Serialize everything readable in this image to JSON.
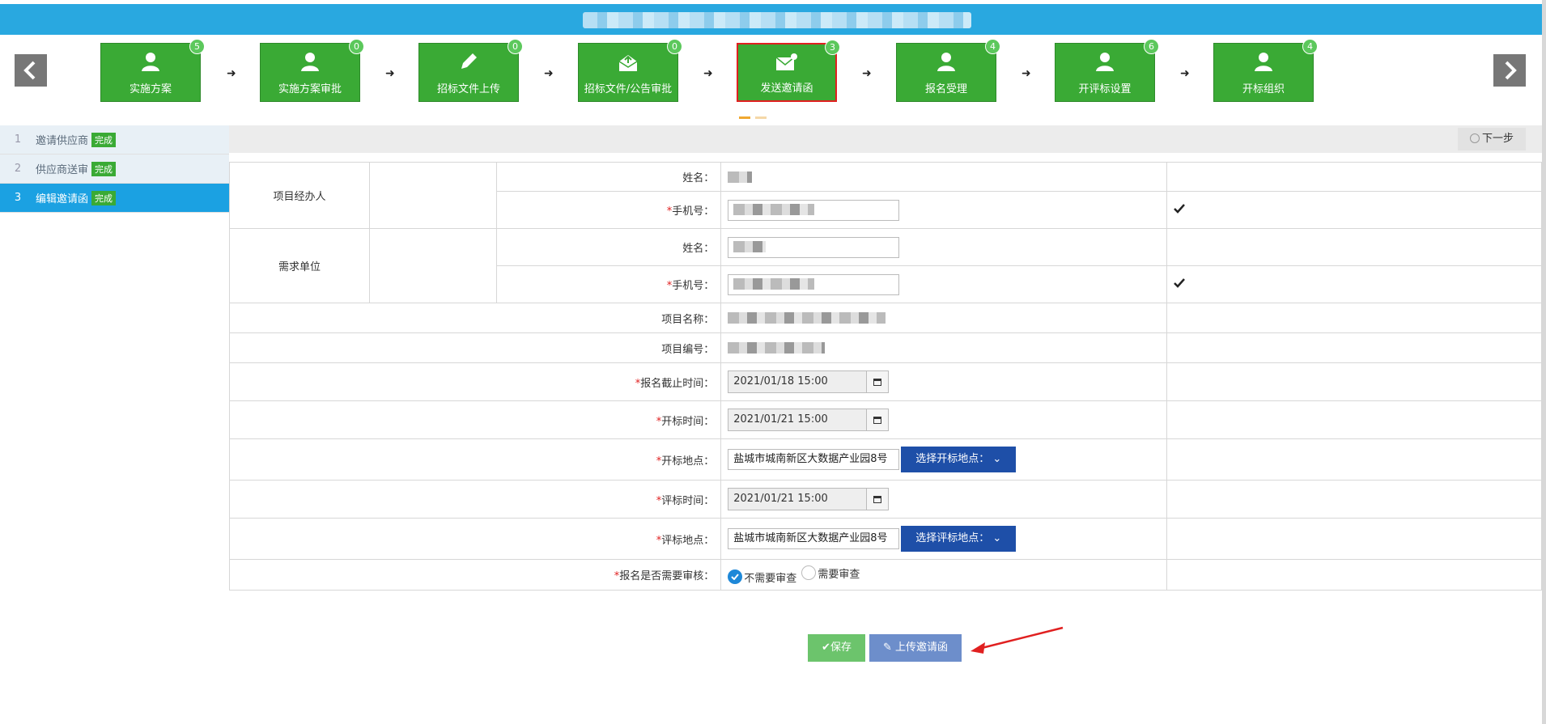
{
  "workflow": {
    "prev_icon": "chevron-left-icon",
    "next_icon": "chevron-right-icon",
    "steps": [
      {
        "label": "实施方案",
        "badge": "5",
        "icon": "user-icon"
      },
      {
        "label": "实施方案审批",
        "badge": "0",
        "icon": "user-icon"
      },
      {
        "label": "招标文件上传",
        "badge": "0",
        "icon": "pencil-icon"
      },
      {
        "label": "招标文件/公告审批",
        "badge": "0",
        "icon": "mail-upload-icon"
      },
      {
        "label": "发送邀请函",
        "badge": "3",
        "icon": "mail-send-icon",
        "active": true
      },
      {
        "label": "报名受理",
        "badge": "4",
        "icon": "user-icon"
      },
      {
        "label": "开评标设置",
        "badge": "6",
        "icon": "user-icon"
      },
      {
        "label": "开标组织",
        "badge": "4",
        "icon": "user-icon"
      }
    ]
  },
  "sidebar": {
    "items": [
      {
        "num": "1",
        "label": "邀请供应商",
        "status": "完成"
      },
      {
        "num": "2",
        "label": "供应商送审",
        "status": "完成"
      },
      {
        "num": "3",
        "label": "编辑邀请函",
        "status": "完成",
        "active": true
      }
    ]
  },
  "toolbar": {
    "next_label": "下一步"
  },
  "form": {
    "group_manager": "项目经办人",
    "group_dept": "需求单位",
    "name_label": "姓名：",
    "phone_label": "手机号：",
    "required_mark": "*",
    "project_name_label": "项目名称：",
    "project_no_label": "项目编号：",
    "signup_deadline_label": "报名截止时间：",
    "signup_deadline_value": "2021/01/18 15:00",
    "open_time_label": "开标时间：",
    "open_time_value": "2021/01/21 15:00",
    "open_place_label": "开标地点：",
    "open_place_value": "盐城市城南新区大数据产业园8号",
    "open_place_button": "选择开标地点：",
    "eval_time_label": "评标时间：",
    "eval_time_value": "2021/01/21 15:00",
    "eval_place_label": "评标地点：",
    "eval_place_value": "盐城市城南新区大数据产业园8号",
    "eval_place_button": "选择评标地点：",
    "review_label": "报名是否需要审核：",
    "review_options": [
      {
        "label": "不需要审查",
        "selected": true
      },
      {
        "label": "需要审查",
        "selected": false
      }
    ]
  },
  "actions": {
    "save_label": "保存",
    "upload_label": "上传邀请函"
  },
  "colors": {
    "banner": "#29a8e0",
    "step_green": "#3aaa35",
    "active_border": "#e02020",
    "sidebar_active": "#1ba1e2",
    "select_btn": "#1e4fa8",
    "save_btn": "#6cc46c",
    "upload_btn": "#6d8ecb"
  }
}
